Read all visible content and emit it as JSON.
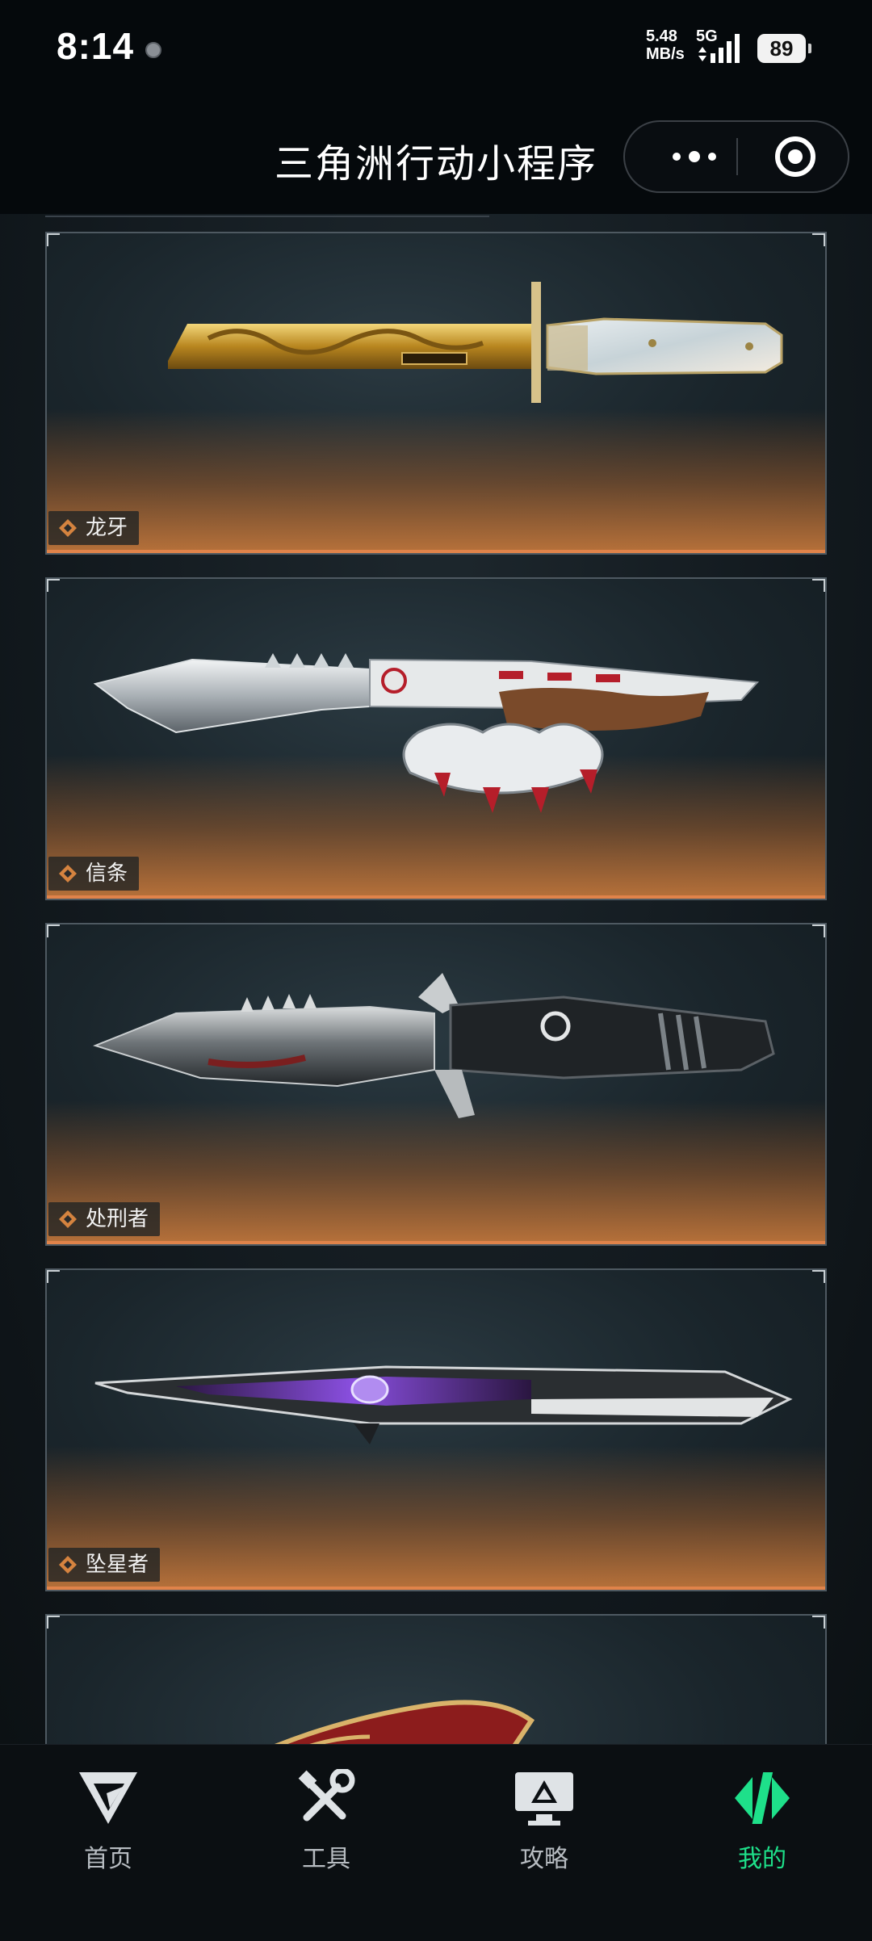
{
  "status_bar": {
    "time": "8:14",
    "net_speed_value": "5.48",
    "net_speed_unit": "MB/s",
    "network": "5G",
    "battery": "89"
  },
  "title_bar": {
    "title": "三角洲行动小程序",
    "more_icon": "more-dots-icon",
    "close_icon": "target-close-icon"
  },
  "cards": [
    {
      "label": "龙牙",
      "weapon_icon": "gold-dragon-knife"
    },
    {
      "label": "信条",
      "weapon_icon": "knuckle-knife"
    },
    {
      "label": "处刑者",
      "weapon_icon": "executioner-knife"
    },
    {
      "label": "坠星者",
      "weapon_icon": "purple-star-knife"
    },
    {
      "label": "",
      "weapon_icon": "red-dragon-knife-partial"
    }
  ],
  "nav": [
    {
      "label": "首页",
      "icon": "home-logo-icon",
      "active": false
    },
    {
      "label": "工具",
      "icon": "tools-icon",
      "active": false
    },
    {
      "label": "攻略",
      "icon": "guide-monitor-icon",
      "active": false
    },
    {
      "label": "我的",
      "icon": "me-logo-icon",
      "active": true
    }
  ],
  "colors": {
    "accent": "#1ee08a",
    "card_glow": "#e0834a"
  }
}
